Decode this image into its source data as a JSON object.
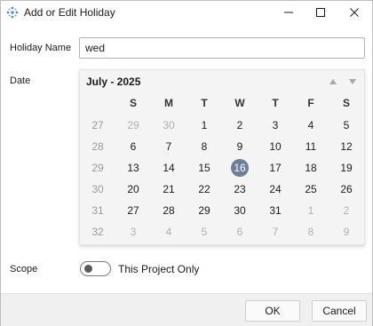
{
  "window": {
    "title": "Add or Edit Holiday",
    "icon": "holiday-app-icon",
    "accent_color": "#4a7fc1"
  },
  "form": {
    "holiday_name_label": "Holiday Name",
    "holiday_name_value": "wed",
    "date_label": "Date",
    "scope_label": "Scope"
  },
  "calendar": {
    "month_title": "July - 2025",
    "selected_day": "16",
    "selected_color": "#6b7f99",
    "day_headers": [
      "S",
      "M",
      "T",
      "W",
      "T",
      "F",
      "S"
    ],
    "weeks": [
      {
        "week": "27",
        "days": [
          {
            "d": "29",
            "other": true
          },
          {
            "d": "30",
            "other": true
          },
          {
            "d": "1"
          },
          {
            "d": "2"
          },
          {
            "d": "3"
          },
          {
            "d": "4"
          },
          {
            "d": "5"
          }
        ]
      },
      {
        "week": "28",
        "days": [
          {
            "d": "6"
          },
          {
            "d": "7"
          },
          {
            "d": "8"
          },
          {
            "d": "9"
          },
          {
            "d": "10"
          },
          {
            "d": "11"
          },
          {
            "d": "12"
          }
        ]
      },
      {
        "week": "29",
        "days": [
          {
            "d": "13"
          },
          {
            "d": "14"
          },
          {
            "d": "15"
          },
          {
            "d": "16",
            "selected": true
          },
          {
            "d": "17"
          },
          {
            "d": "18"
          },
          {
            "d": "19"
          }
        ]
      },
      {
        "week": "30",
        "days": [
          {
            "d": "20"
          },
          {
            "d": "21"
          },
          {
            "d": "22"
          },
          {
            "d": "23"
          },
          {
            "d": "24"
          },
          {
            "d": "25"
          },
          {
            "d": "26"
          }
        ]
      },
      {
        "week": "31",
        "days": [
          {
            "d": "27"
          },
          {
            "d": "28"
          },
          {
            "d": "29"
          },
          {
            "d": "30"
          },
          {
            "d": "31"
          },
          {
            "d": "1",
            "other": true
          },
          {
            "d": "2",
            "other": true
          }
        ]
      },
      {
        "week": "32",
        "days": [
          {
            "d": "3",
            "other": true
          },
          {
            "d": "4",
            "other": true
          },
          {
            "d": "5",
            "other": true
          },
          {
            "d": "6",
            "other": true
          },
          {
            "d": "7",
            "other": true
          },
          {
            "d": "8",
            "other": true
          },
          {
            "d": "9",
            "other": true
          }
        ]
      }
    ]
  },
  "scope": {
    "toggle_on": false,
    "toggle_label": "This Project Only"
  },
  "footer": {
    "ok_label": "OK",
    "cancel_label": "Cancel"
  }
}
